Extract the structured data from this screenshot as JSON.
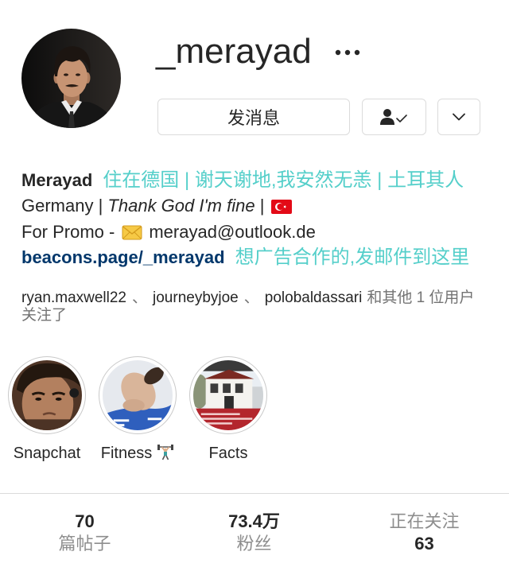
{
  "profile": {
    "username": "_merayad",
    "message_button": "发消息"
  },
  "bio": {
    "full_name": "Merayad",
    "full_name_translation": "住在德国 | 谢天谢地,我安然无恙 | 土耳其人",
    "location_line": {
      "prefix": "Germany | ",
      "tagline": "Thank God I'm fine",
      "separator": " | "
    },
    "promo_line": {
      "prefix": "For Promo -",
      "email": "merayad@outlook.de"
    },
    "link": "beacons.page/_merayad",
    "link_translation": "想广告合作的,发邮件到这里"
  },
  "followed_by": {
    "users": [
      "ryan.maxwell22",
      "journeybyjoe",
      "polobaldassari"
    ],
    "separator": "、",
    "suffix": "和其他 1 位用户",
    "line2": "关注了"
  },
  "highlights": [
    {
      "label": "Snapchat"
    },
    {
      "label": "Fitness"
    },
    {
      "label": "Facts"
    }
  ],
  "stats": {
    "posts": {
      "value": "70",
      "label": "篇帖子"
    },
    "followers": {
      "value": "73.4万",
      "label": "粉丝"
    },
    "following": {
      "value": "63",
      "label": "正在关注"
    }
  },
  "icons": {
    "more": "more-horizontal-icon",
    "following": "person-check-icon",
    "suggestions": "chevron-down-icon",
    "flag": "turkey-flag-icon",
    "email": "envelope-icon",
    "fitness": "weightlifter-icon"
  },
  "colors": {
    "text": "#262626",
    "secondary_text": "#8e8e8e",
    "link": "#00376b",
    "translation": "#55cfca",
    "border": "#dbdbdb"
  }
}
